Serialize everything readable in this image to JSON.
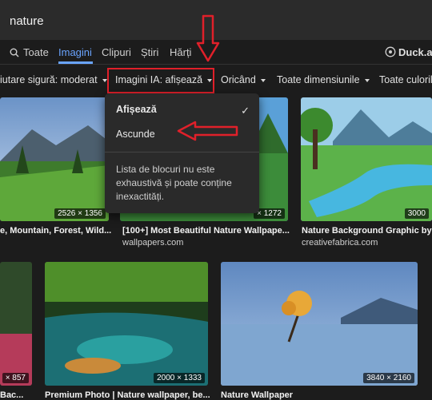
{
  "search": {
    "query": "nature"
  },
  "tabs": [
    {
      "label": "Toate"
    },
    {
      "label": "Imagini"
    },
    {
      "label": "Clipuri"
    },
    {
      "label": "Știri"
    },
    {
      "label": "Hărți"
    }
  ],
  "brand": {
    "label": "Duck.ai"
  },
  "filters": {
    "safe_search": "iutare sigură: moderat",
    "ai_images": "Imagini IA: afișează",
    "time": "Oricând",
    "size": "Toate dimensiunile",
    "color": "Toate culorile"
  },
  "dropdown": {
    "show_label": "Afișează",
    "hide_label": "Ascunde",
    "note": "Lista de blocuri nu este exhaustivă și poate conține inexactități."
  },
  "results": [
    {
      "caption": "e, Mountain, Forest, Wild...",
      "dims": "2526 × 1356"
    },
    {
      "caption": "[100+] Most Beautiful Nature Wallpape...",
      "source": "wallpapers.com",
      "dims": "× 1272"
    },
    {
      "caption": "Nature Background Graphic by F",
      "source": "creativefabrica.com",
      "dims": "3000"
    },
    {
      "caption": "Bac...",
      "dims": "× 857"
    },
    {
      "caption": "Premium Photo | Nature wallpaper, be...",
      "dims": "2000 × 1333"
    },
    {
      "caption": "Nature Wallpaper",
      "dims": "3840 × 2160"
    }
  ],
  "colors": {
    "accent": "#6aa4ff",
    "annotation_red": "#e0202a"
  }
}
